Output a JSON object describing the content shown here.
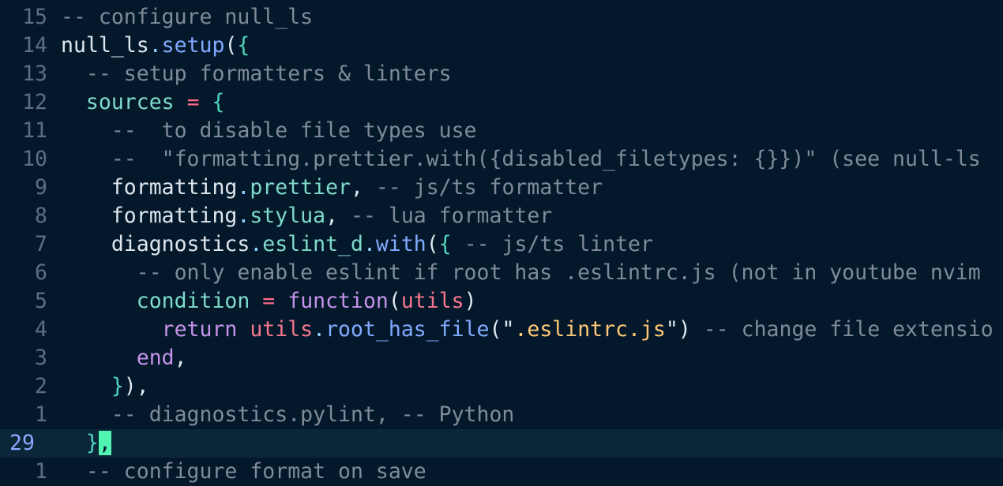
{
  "editor": {
    "lines": [
      {
        "number": "15",
        "current": false,
        "tokens": [
          {
            "text": "-- configure null_ls",
            "type": "comment"
          }
        ]
      },
      {
        "number": "14",
        "current": false,
        "tokens": [
          {
            "text": "null_ls",
            "type": "ident"
          },
          {
            "text": ".",
            "type": "dot"
          },
          {
            "text": "setup",
            "type": "method"
          },
          {
            "text": "(",
            "type": "punct"
          },
          {
            "text": "{",
            "type": "brace"
          }
        ]
      },
      {
        "number": "13",
        "current": false,
        "tokens": [
          {
            "text": "  ",
            "type": "ident"
          },
          {
            "text": "-- setup formatters & linters",
            "type": "comment"
          }
        ]
      },
      {
        "number": "12",
        "current": false,
        "tokens": [
          {
            "text": "  ",
            "type": "ident"
          },
          {
            "text": "sources",
            "type": "property"
          },
          {
            "text": " ",
            "type": "ident"
          },
          {
            "text": "=",
            "type": "operator"
          },
          {
            "text": " ",
            "type": "ident"
          },
          {
            "text": "{",
            "type": "brace"
          }
        ]
      },
      {
        "number": "11",
        "current": false,
        "tokens": [
          {
            "text": "    ",
            "type": "ident"
          },
          {
            "text": "--  to disable file types use",
            "type": "comment"
          }
        ]
      },
      {
        "number": "10",
        "current": false,
        "tokens": [
          {
            "text": "    ",
            "type": "ident"
          },
          {
            "text": "--  \"formatting.prettier.with({disabled_filetypes: {}})\" (see null-ls",
            "type": "comment"
          }
        ]
      },
      {
        "number": "9",
        "current": false,
        "tokens": [
          {
            "text": "    ",
            "type": "ident"
          },
          {
            "text": "formatting",
            "type": "ident"
          },
          {
            "text": ".",
            "type": "dot"
          },
          {
            "text": "prettier",
            "type": "property"
          },
          {
            "text": ", ",
            "type": "punct"
          },
          {
            "text": "-- js/ts formatter",
            "type": "comment"
          }
        ]
      },
      {
        "number": "8",
        "current": false,
        "tokens": [
          {
            "text": "    ",
            "type": "ident"
          },
          {
            "text": "formatting",
            "type": "ident"
          },
          {
            "text": ".",
            "type": "dot"
          },
          {
            "text": "stylua",
            "type": "property"
          },
          {
            "text": ", ",
            "type": "punct"
          },
          {
            "text": "-- lua formatter",
            "type": "comment"
          }
        ]
      },
      {
        "number": "7",
        "current": false,
        "tokens": [
          {
            "text": "    ",
            "type": "ident"
          },
          {
            "text": "diagnostics",
            "type": "ident"
          },
          {
            "text": ".",
            "type": "dot"
          },
          {
            "text": "eslint_d",
            "type": "property"
          },
          {
            "text": ".",
            "type": "dot"
          },
          {
            "text": "with",
            "type": "method"
          },
          {
            "text": "(",
            "type": "punct"
          },
          {
            "text": "{",
            "type": "brace"
          },
          {
            "text": " ",
            "type": "ident"
          },
          {
            "text": "-- js/ts linter",
            "type": "comment"
          }
        ]
      },
      {
        "number": "6",
        "current": false,
        "tokens": [
          {
            "text": "      ",
            "type": "ident"
          },
          {
            "text": "-- only enable eslint if root has .eslintrc.js (not in youtube nvim",
            "type": "comment"
          }
        ]
      },
      {
        "number": "5",
        "current": false,
        "tokens": [
          {
            "text": "      ",
            "type": "ident"
          },
          {
            "text": "condition",
            "type": "property"
          },
          {
            "text": " ",
            "type": "ident"
          },
          {
            "text": "=",
            "type": "operator"
          },
          {
            "text": " ",
            "type": "ident"
          },
          {
            "text": "function",
            "type": "keyword"
          },
          {
            "text": "(",
            "type": "punct"
          },
          {
            "text": "utils",
            "type": "param"
          },
          {
            "text": ")",
            "type": "punct"
          }
        ]
      },
      {
        "number": "4",
        "current": false,
        "tokens": [
          {
            "text": "        ",
            "type": "ident"
          },
          {
            "text": "return",
            "type": "keyword"
          },
          {
            "text": " ",
            "type": "ident"
          },
          {
            "text": "utils",
            "type": "param"
          },
          {
            "text": ".",
            "type": "dot"
          },
          {
            "text": "root_has_file",
            "type": "method"
          },
          {
            "text": "(\"",
            "type": "punct"
          },
          {
            "text": ".eslintrc.js",
            "type": "string"
          },
          {
            "text": "\")",
            "type": "punct"
          },
          {
            "text": " ",
            "type": "ident"
          },
          {
            "text": "-- change file extensio",
            "type": "comment"
          }
        ]
      },
      {
        "number": "3",
        "current": false,
        "tokens": [
          {
            "text": "      ",
            "type": "ident"
          },
          {
            "text": "end",
            "type": "keyword"
          },
          {
            "text": ",",
            "type": "punct"
          }
        ]
      },
      {
        "number": "2",
        "current": false,
        "tokens": [
          {
            "text": "    ",
            "type": "ident"
          },
          {
            "text": "}",
            "type": "brace"
          },
          {
            "text": "),",
            "type": "punct"
          }
        ]
      },
      {
        "number": "1",
        "current": false,
        "tokens": [
          {
            "text": "    ",
            "type": "ident"
          },
          {
            "text": "-- diagnostics.pylint, -- Python",
            "type": "comment"
          }
        ]
      },
      {
        "number": "29",
        "current": true,
        "tokens": [
          {
            "text": "  ",
            "type": "ident"
          },
          {
            "text": "}",
            "type": "brace"
          },
          {
            "text": ",",
            "type": "cursor"
          }
        ]
      },
      {
        "number": "1",
        "current": false,
        "tokens": [
          {
            "text": "  ",
            "type": "ident"
          },
          {
            "text": "-- configure format on save",
            "type": "comment"
          }
        ]
      }
    ]
  }
}
